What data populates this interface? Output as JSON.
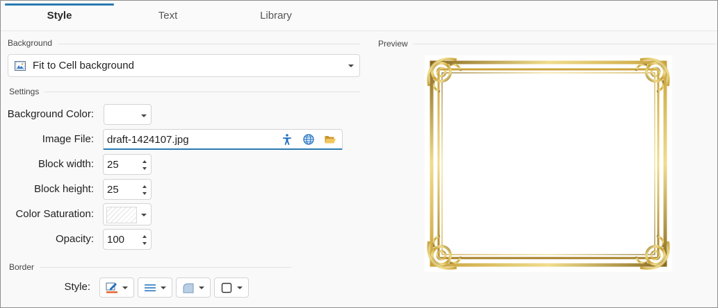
{
  "tabs": [
    {
      "label": "Style",
      "active": true
    },
    {
      "label": "Text",
      "active": false
    },
    {
      "label": "Library",
      "active": false
    }
  ],
  "background": {
    "section_label": "Background",
    "mode_value": "Fit to Cell background",
    "mode_icon": "picture-fill-icon"
  },
  "settings": {
    "section_label": "Settings",
    "background_color_label": "Background Color:",
    "image_file_label": "Image File:",
    "image_file_value": "draft-1424107.jpg",
    "image_file_icons": [
      "accessibility-icon",
      "web-globe-icon",
      "open-folder-icon"
    ],
    "block_width_label": "Block width:",
    "block_width_value": "25",
    "block_height_label": "Block height:",
    "block_height_value": "25",
    "color_saturation_label": "Color Saturation:",
    "opacity_label": "Opacity:",
    "opacity_value": "100"
  },
  "border": {
    "section_label": "Border",
    "style_label": "Style:",
    "buttons": [
      "pen-color-icon",
      "line-weight-icon",
      "corner-rounding-icon",
      "border-square-icon"
    ]
  },
  "preview": {
    "section_label": "Preview",
    "frame_gold": "#c9a23a",
    "frame_gold_light": "#f0dd8e",
    "frame_gold_dark": "#8a6a1e"
  },
  "colors": {
    "accent": "#2a7ab0",
    "icon_blue": "#1f6fbf",
    "folder_yellow": "#e8b94a"
  }
}
